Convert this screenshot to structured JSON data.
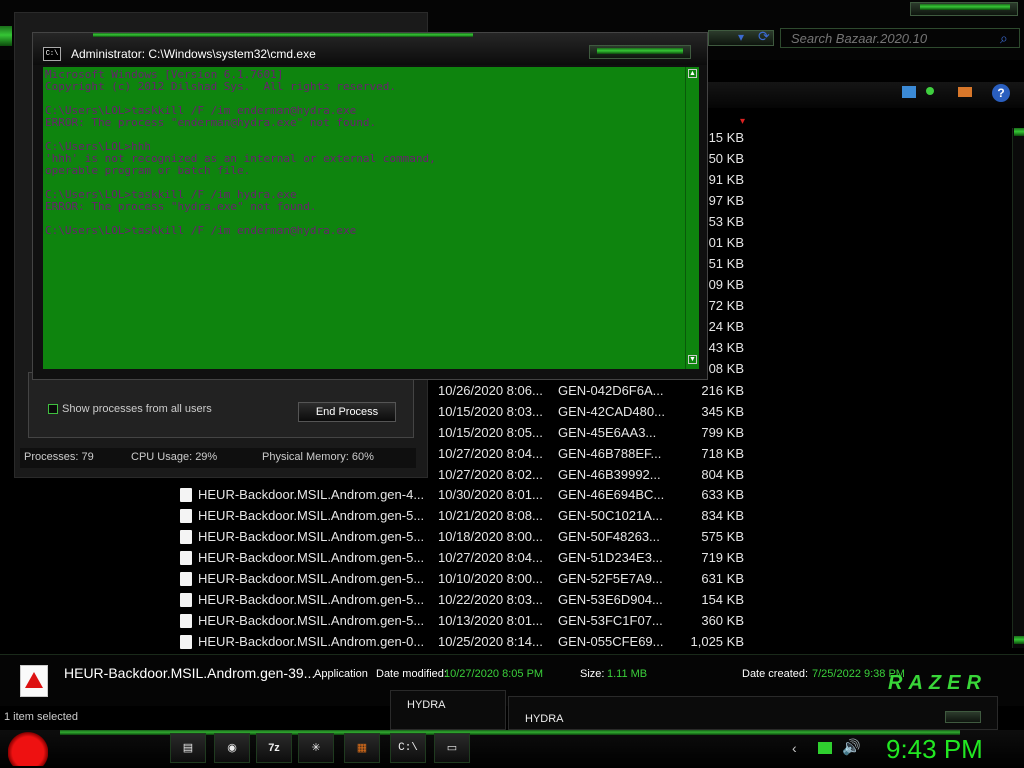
{
  "search": {
    "placeholder": "Search Bazaar.2020.10"
  },
  "cmd": {
    "title": "Administrator: C:\\Windows\\system32\\cmd.exe",
    "lines": [
      "Microsoft Windows [Version 6.1.7601]",
      "Copyright (c) 2012 Dilshad Sys.  All rights reserved.",
      "",
      "C:\\Users\\LOL>taskkill /F /im enderman@hydra.exe",
      "ERROR: The process \"enderman@hydra.exe\" not found.",
      "",
      "C:\\Users\\LOL>hhh",
      "'hhh' is not recognized as an internal or external command,",
      "operable program or batch file.",
      "",
      "C:\\Users\\LOL>taskkill /F /im hydra.exe",
      "ERROR: The process \"hydra.exe\" not found.",
      "",
      "C:\\Users\\LOL>taskkill /F /im enderman@hydra.exe"
    ]
  },
  "taskmgr": {
    "show_all": "Show processes from all users",
    "end_process": "End Process",
    "processes": "Processes: 79",
    "cpu": "CPU Usage: 29%",
    "memory": "Physical Memory: 60%"
  },
  "size_fragments": [
    "15 KB",
    "50 KB",
    "91 KB",
    "97 KB",
    "53 KB",
    "01 KB",
    "51 KB",
    "09 KB",
    "72 KB",
    "24 KB",
    "43 KB",
    "08 KB"
  ],
  "files_partial": [
    {
      "date": "10/26/2020 8:06...",
      "type": "GEN-042D6F6A...",
      "size": "216 KB"
    },
    {
      "date": "10/15/2020 8:03...",
      "type": "GEN-42CAD480...",
      "size": "345 KB"
    },
    {
      "date": "10/15/2020 8:05...",
      "type": "GEN-45E6AA3...",
      "size": "799 KB"
    },
    {
      "date": "10/27/2020 8:04...",
      "type": "GEN-46B788EF...",
      "size": "718 KB"
    },
    {
      "date": "10/27/2020 8:02...",
      "type": "GEN-46B39992...",
      "size": "804 KB"
    }
  ],
  "files": [
    {
      "name": "HEUR-Backdoor.MSIL.Androm.gen-4...",
      "date": "10/30/2020 8:01...",
      "type": "GEN-46E694BC...",
      "size": "633 KB"
    },
    {
      "name": "HEUR-Backdoor.MSIL.Androm.gen-5...",
      "date": "10/21/2020 8:08...",
      "type": "GEN-50C1021A...",
      "size": "834 KB"
    },
    {
      "name": "HEUR-Backdoor.MSIL.Androm.gen-5...",
      "date": "10/18/2020 8:00...",
      "type": "GEN-50F48263...",
      "size": "575 KB"
    },
    {
      "name": "HEUR-Backdoor.MSIL.Androm.gen-5...",
      "date": "10/27/2020 8:04...",
      "type": "GEN-51D234E3...",
      "size": "719 KB"
    },
    {
      "name": "HEUR-Backdoor.MSIL.Androm.gen-5...",
      "date": "10/10/2020 8:00...",
      "type": "GEN-52F5E7A9...",
      "size": "631 KB"
    },
    {
      "name": "HEUR-Backdoor.MSIL.Androm.gen-5...",
      "date": "10/22/2020 8:03...",
      "type": "GEN-53E6D904...",
      "size": "154 KB"
    },
    {
      "name": "HEUR-Backdoor.MSIL.Androm.gen-5...",
      "date": "10/13/2020 8:01...",
      "type": "GEN-53FC1F07...",
      "size": "360 KB"
    },
    {
      "name": "HEUR-Backdoor.MSIL.Androm.gen-0...",
      "date": "10/25/2020 8:14...",
      "type": "GEN-055CFE69...",
      "size": "1,025 KB"
    }
  ],
  "details": {
    "filename": "HEUR-Backdoor.MSIL.Androm.gen-39...",
    "kind": "Application",
    "modified_label": "Date modified:",
    "modified": "10/27/2020 8:05 PM",
    "size_label": "Size:",
    "size": "1.11 MB",
    "created_label": "Date created:",
    "created": "7/25/2022 9:38 PM",
    "selected": "1 item selected"
  },
  "brand": "RAZER",
  "hydra_windows": [
    "HYDRA",
    "HYDRA"
  ],
  "taskbar": {
    "clock": "9:43 PM",
    "cmd_label": "C:\\"
  },
  "colors": {
    "accent": "#22e822",
    "cmd_bg": "#0e840e",
    "cmd_text": "#6a2070"
  }
}
